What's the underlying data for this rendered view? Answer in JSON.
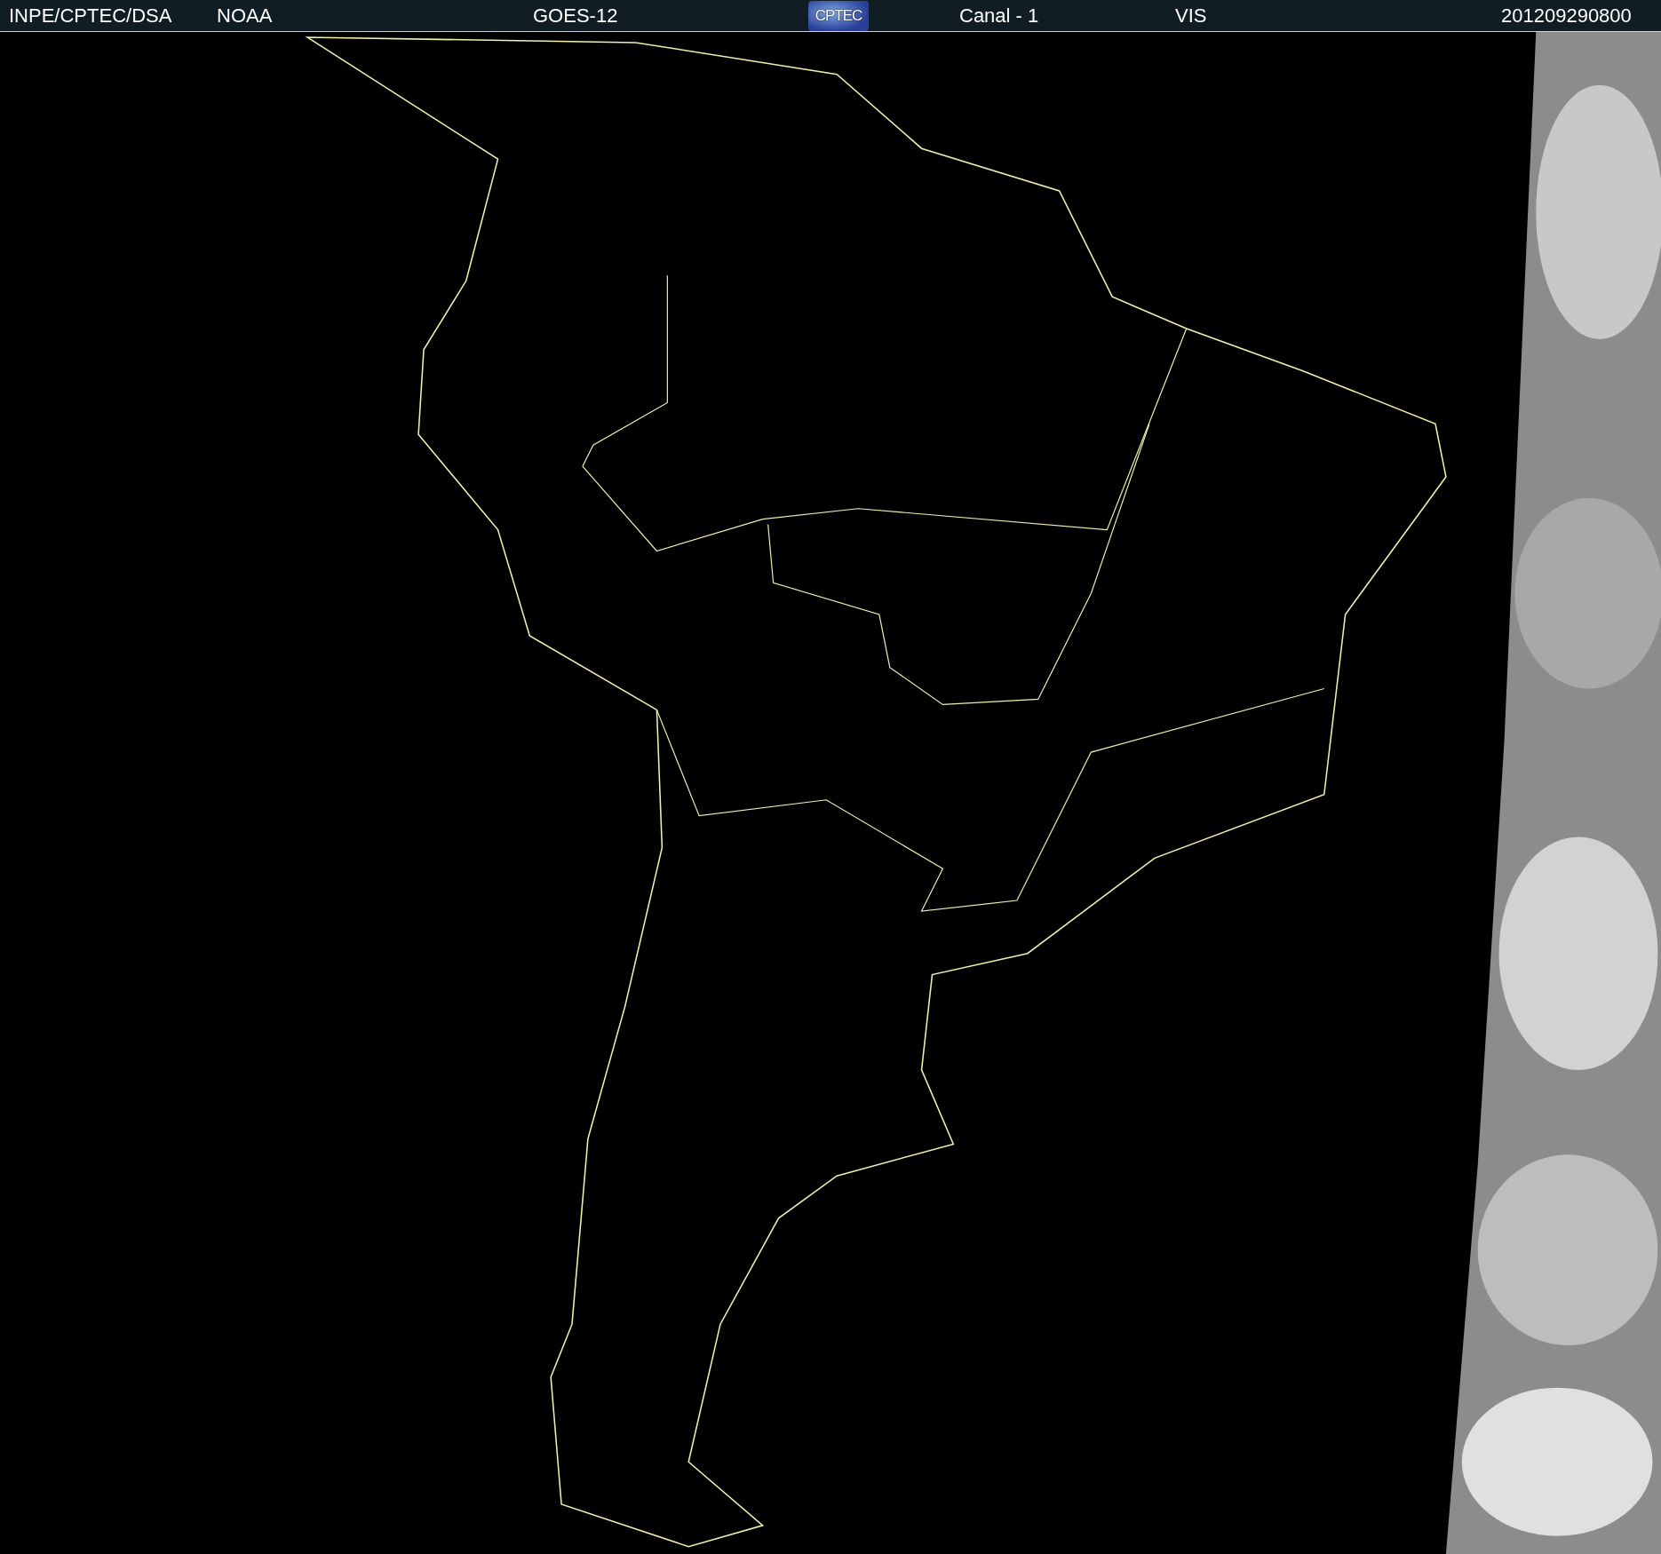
{
  "header": {
    "items": [
      {
        "text": "INPE/CPTEC/DSA"
      },
      {
        "text": "NOAA"
      },
      {
        "text": "GOES-12"
      },
      {
        "text": "Canal - 1"
      },
      {
        "text": "VIS"
      },
      {
        "text": "201209290800"
      }
    ],
    "logo": {
      "text": "CPTEC"
    }
  }
}
